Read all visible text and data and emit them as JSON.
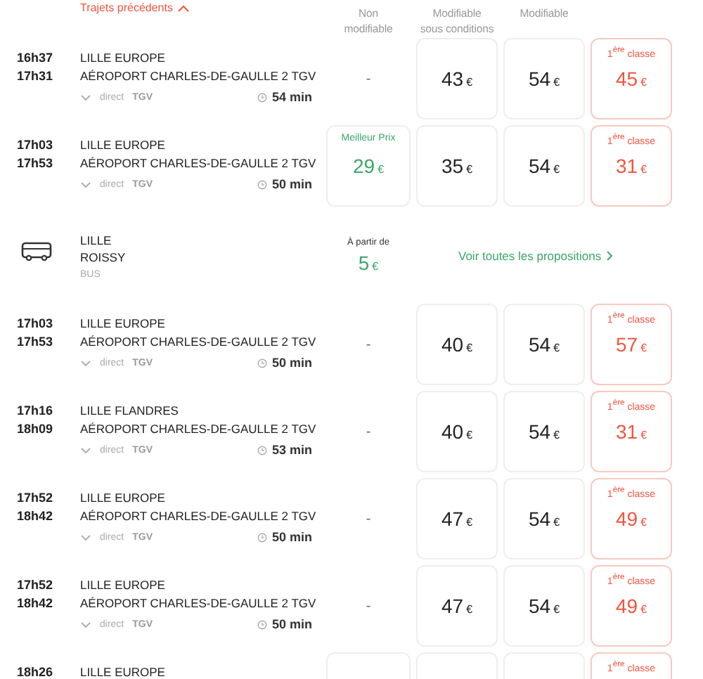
{
  "previous_trips": {
    "label": "Trajets précédents"
  },
  "columns": [
    "Non\nmodifiable",
    "Modifiable\nsous conditions",
    "Modifiable"
  ],
  "rows": [
    {
      "kind": "train",
      "departure": "16h37",
      "arrival": "17h31",
      "origin": "LILLE EUROPE",
      "destination": "AÉROPORT CHARLES-DE-GAULLE 2 TGV",
      "type": "direct",
      "train": "TGV",
      "duration": "54 min",
      "fares": [
        {
          "kind": "none",
          "text": "-"
        },
        {
          "kind": "standard",
          "price": "43",
          "currency": "€"
        },
        {
          "kind": "standard",
          "price": "54",
          "currency": "€"
        },
        {
          "kind": "first",
          "label": "1$^{ère}$ classe",
          "price": "45",
          "currency": "€"
        }
      ]
    },
    {
      "kind": "train",
      "departure": "17h03",
      "arrival": "17h53",
      "origin": "LILLE EUROPE",
      "destination": "AÉROPORT CHARLES-DE-GAULLE 2 TGV",
      "type": "direct",
      "train": "TGV",
      "duration": "50 min",
      "fares": [
        {
          "kind": "best",
          "label": "Meilleur Prix",
          "price": "29",
          "currency": "€"
        },
        {
          "kind": "standard",
          "price": "35",
          "currency": "€"
        },
        {
          "kind": "standard",
          "price": "54",
          "currency": "€"
        },
        {
          "kind": "first",
          "label": "1$^{ère}$ classe",
          "price": "31",
          "currency": "€"
        }
      ]
    },
    {
      "kind": "bus",
      "origin": "LILLE",
      "destination": "ROISSY",
      "mode": "BUS",
      "from_label": "À partir de",
      "price": "5",
      "currency": "€",
      "link": "Voir toutes les propositions"
    },
    {
      "kind": "train",
      "departure": "17h03",
      "arrival": "17h53",
      "origin": "LILLE EUROPE",
      "destination": "AÉROPORT CHARLES-DE-GAULLE 2 TGV",
      "type": "direct",
      "train": "TGV",
      "duration": "50 min",
      "fares": [
        {
          "kind": "none",
          "text": "-"
        },
        {
          "kind": "standard",
          "price": "40",
          "currency": "€"
        },
        {
          "kind": "standard",
          "price": "54",
          "currency": "€"
        },
        {
          "kind": "first",
          "label": "1$^{ère}$ classe",
          "price": "57",
          "currency": "€"
        }
      ]
    },
    {
      "kind": "train",
      "departure": "17h16",
      "arrival": "18h09",
      "origin": "LILLE FLANDRES",
      "destination": "AÉROPORT CHARLES-DE-GAULLE 2 TGV",
      "type": "direct",
      "train": "TGV",
      "duration": "53 min",
      "fares": [
        {
          "kind": "none",
          "text": "-"
        },
        {
          "kind": "standard",
          "price": "40",
          "currency": "€"
        },
        {
          "kind": "standard",
          "price": "54",
          "currency": "€"
        },
        {
          "kind": "first",
          "label": "1$^{ère}$ classe",
          "price": "31",
          "currency": "€"
        }
      ]
    },
    {
      "kind": "train",
      "departure": "17h52",
      "arrival": "18h42",
      "origin": "LILLE EUROPE",
      "destination": "AÉROPORT CHARLES-DE-GAULLE 2 TGV",
      "type": "direct",
      "train": "TGV",
      "duration": "50 min",
      "fares": [
        {
          "kind": "none",
          "text": "-"
        },
        {
          "kind": "standard",
          "price": "47",
          "currency": "€"
        },
        {
          "kind": "standard",
          "price": "54",
          "currency": "€"
        },
        {
          "kind": "first",
          "label": "1$^{ère}$ classe",
          "price": "49",
          "currency": "€"
        }
      ]
    },
    {
      "kind": "train",
      "departure": "17h52",
      "arrival": "18h42",
      "origin": "LILLE EUROPE",
      "destination": "AÉROPORT CHARLES-DE-GAULLE 2 TGV",
      "type": "direct",
      "train": "TGV",
      "duration": "50 min",
      "fares": [
        {
          "kind": "none",
          "text": "-"
        },
        {
          "kind": "standard",
          "price": "47",
          "currency": "€"
        },
        {
          "kind": "standard",
          "price": "54",
          "currency": "€"
        },
        {
          "kind": "first",
          "label": "1$^{ère}$ classe",
          "price": "49",
          "currency": "€"
        }
      ]
    },
    {
      "kind": "train",
      "departure": "18h26",
      "origin": "LILLE EUROPE",
      "fares": [
        {
          "kind": "blank"
        },
        {
          "kind": "blank"
        },
        {
          "kind": "blank"
        },
        {
          "kind": "first",
          "label": "1$^{ère}$ classe"
        }
      ]
    }
  ]
}
